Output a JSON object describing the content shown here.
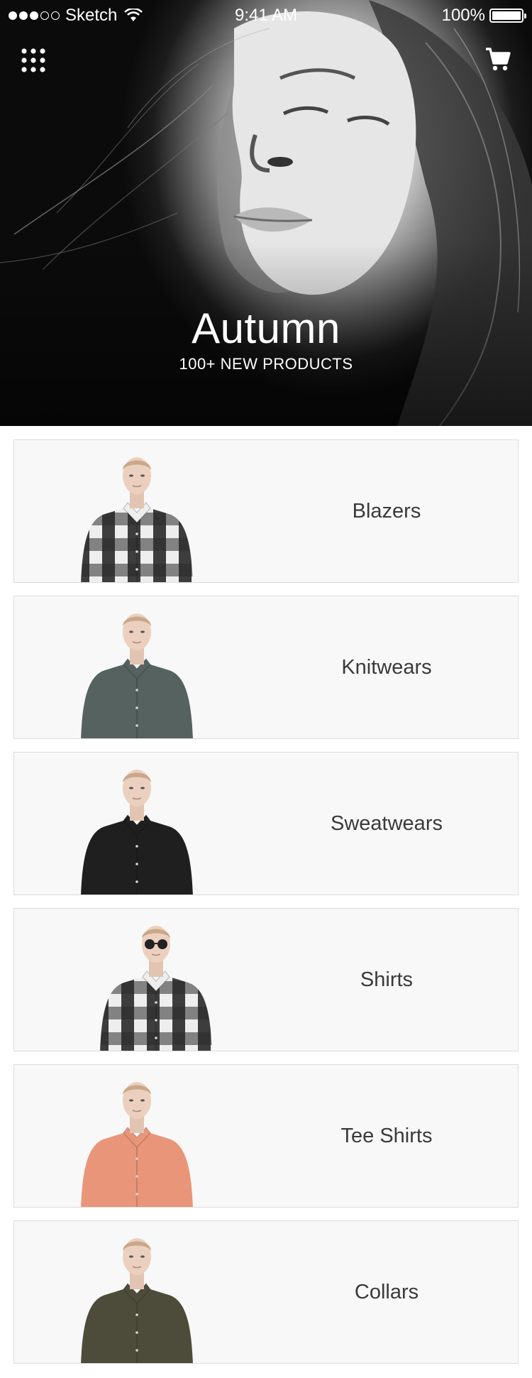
{
  "status_bar": {
    "carrier": "Sketch",
    "time": "9:41 AM",
    "battery": "100%"
  },
  "header": {
    "menu_icon": "grid-menu-icon",
    "cart_icon": "shopping-cart-icon"
  },
  "hero": {
    "title": "Autumn",
    "subtitle": "100+ NEW PRODUCTS"
  },
  "categories": [
    {
      "label": "Blazers",
      "shirt": "black-white plaid",
      "color": "#2a2a2a",
      "accent": "#eeeeee",
      "glasses": false
    },
    {
      "label": "Knitwears",
      "shirt": "slate green",
      "color": "#56625f",
      "accent": "#56625f",
      "glasses": false
    },
    {
      "label": "Sweatwears",
      "shirt": "black",
      "color": "#1f1f1f",
      "accent": "#1f1f1f",
      "glasses": false
    },
    {
      "label": "Shirts",
      "shirt": "black-white plaid",
      "color": "#2a2a2a",
      "accent": "#eeeeee",
      "glasses": true
    },
    {
      "label": "Tee Shirts",
      "shirt": "salmon",
      "color": "#e9957a",
      "accent": "#e9957a",
      "glasses": false
    },
    {
      "label": "Collars",
      "shirt": "olive",
      "color": "#4d4c3b",
      "accent": "#4d4c3b",
      "glasses": false
    }
  ]
}
